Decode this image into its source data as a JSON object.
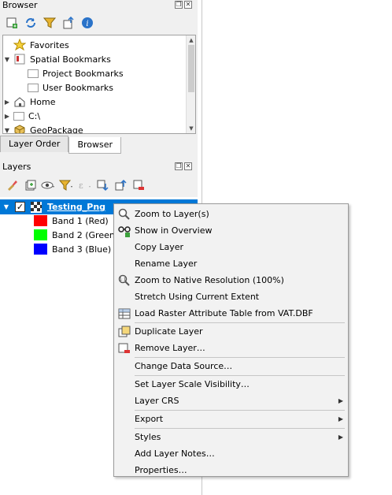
{
  "browser_panel": {
    "title": "Browser",
    "tree": [
      {
        "label": "Favorites",
        "icon": "star-icon"
      },
      {
        "label": "Spatial Bookmarks",
        "icon": "bookmarks-icon",
        "expanded": true
      },
      {
        "label": "Project Bookmarks",
        "icon": "folder-icon"
      },
      {
        "label": "User Bookmarks",
        "icon": "folder-icon"
      },
      {
        "label": "Home",
        "icon": "home-icon"
      },
      {
        "label": "C:\\",
        "icon": "folder-icon"
      },
      {
        "label": "GeoPackage",
        "icon": "geopackage-icon"
      }
    ]
  },
  "tabs": [
    {
      "label": "Layer Order",
      "active": false
    },
    {
      "label": "Browser",
      "active": true
    }
  ],
  "layers_panel": {
    "title": "Layers",
    "layer": {
      "name": "Testing_Png",
      "checked": true
    },
    "bands": [
      {
        "label": "Band 1 (Red)",
        "color": "#ff0000"
      },
      {
        "label": "Band 2 (Green)",
        "color": "#00ff00"
      },
      {
        "label": "Band 3 (Blue)",
        "color": "#0000ff"
      }
    ]
  },
  "context_menu": {
    "items": [
      {
        "label": "Zoom to Layer(s)",
        "icon": "zoom-layer-icon"
      },
      {
        "label": "Show in Overview",
        "icon": "overview-icon"
      },
      {
        "label": "Copy Layer"
      },
      {
        "label": "Rename Layer"
      },
      {
        "label": "Zoom to Native Resolution (100%)",
        "icon": "native-resolution-icon"
      },
      {
        "label": "Stretch Using Current Extent"
      },
      {
        "label": "Load Raster Attribute Table from VAT.DBF",
        "icon": "attribute-table-icon"
      },
      {
        "label": "Duplicate Layer",
        "icon": "duplicate-icon"
      },
      {
        "label": "Remove Layer…",
        "icon": "remove-icon"
      },
      {
        "label": "Change Data Source…"
      },
      {
        "label": "Set Layer Scale Visibility…"
      },
      {
        "label": "Layer CRS",
        "submenu": true
      },
      {
        "label": "Export",
        "submenu": true
      },
      {
        "label": "Styles",
        "submenu": true
      },
      {
        "label": "Add Layer Notes…"
      },
      {
        "label": "Properties…"
      }
    ]
  },
  "colors": {
    "selection": "#0078d7",
    "menu_bg": "#f2f2f2"
  }
}
